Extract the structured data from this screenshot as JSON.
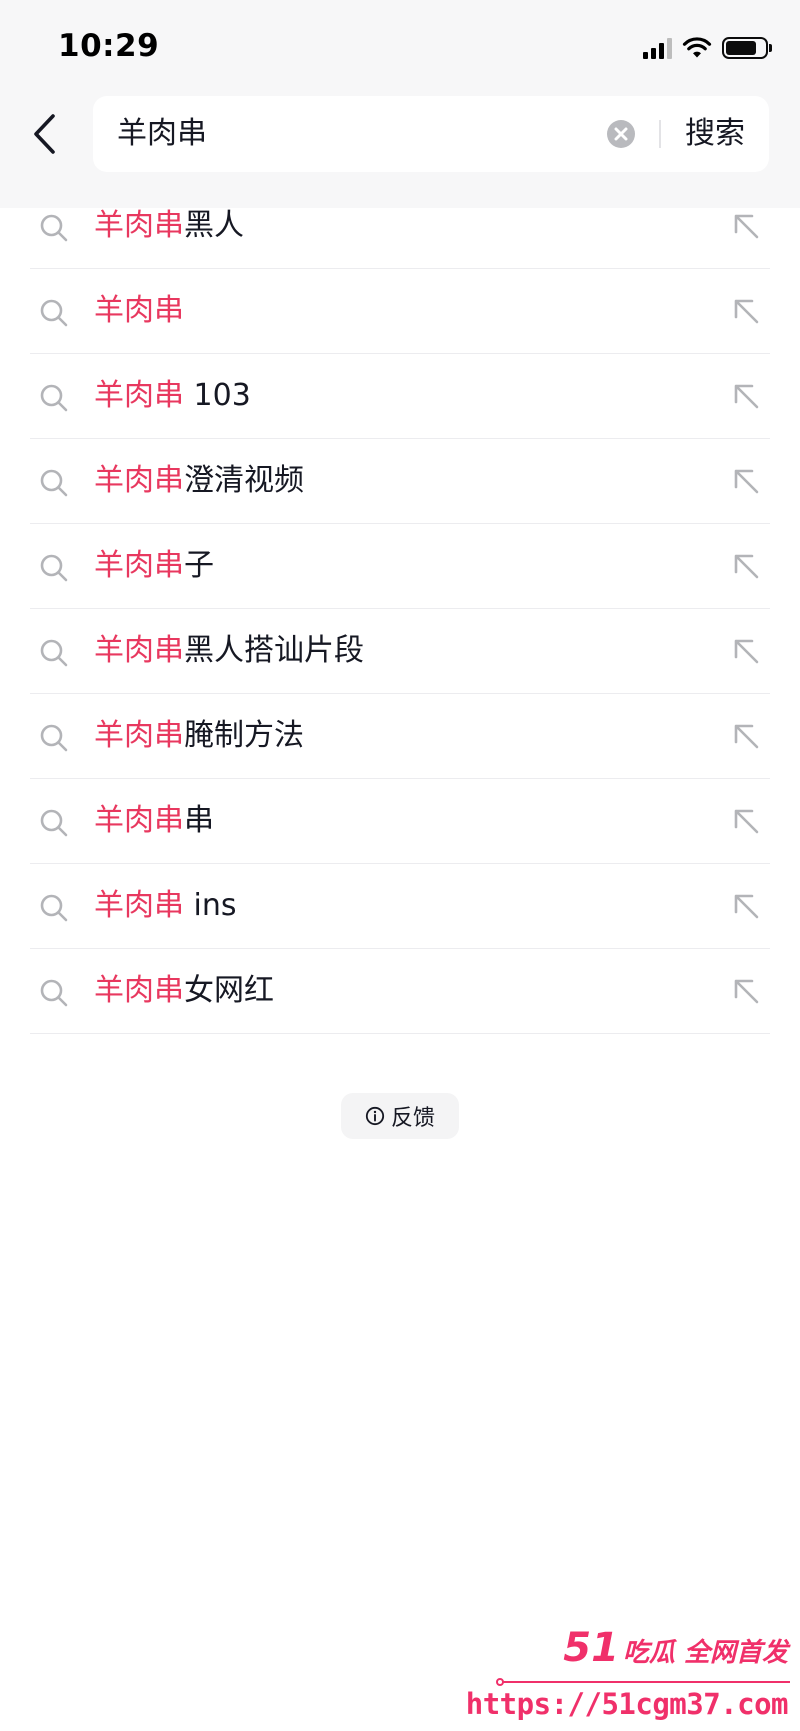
{
  "status_bar": {
    "time": "10:29"
  },
  "header": {
    "back_icon": "chevron-left-icon",
    "search": {
      "value": "羊肉串",
      "clear_icon": "clear-circle-icon",
      "submit_label": "搜索"
    }
  },
  "suggestions": {
    "highlight_color": "#e8385f",
    "items": [
      {
        "highlight": "羊肉串",
        "rest": "黑人"
      },
      {
        "highlight": "羊肉串",
        "rest": ""
      },
      {
        "highlight": "羊肉串",
        "rest": " 103"
      },
      {
        "highlight": "羊肉串",
        "rest": "澄清视频"
      },
      {
        "highlight": "羊肉串",
        "rest": "子"
      },
      {
        "highlight": "羊肉串",
        "rest": "黑人搭讪片段"
      },
      {
        "highlight": "羊肉串",
        "rest": "腌制方法"
      },
      {
        "highlight": "羊肉串",
        "rest": "串"
      },
      {
        "highlight": "羊肉串",
        "rest": " ins"
      },
      {
        "highlight": "羊肉串",
        "rest": "女网红"
      }
    ]
  },
  "feedback": {
    "label": "反馈",
    "icon": "info-icon"
  },
  "watermark": {
    "brand_number": "51",
    "brand_text": "吃瓜 全网首发",
    "url": "https://51cgm37.com"
  }
}
